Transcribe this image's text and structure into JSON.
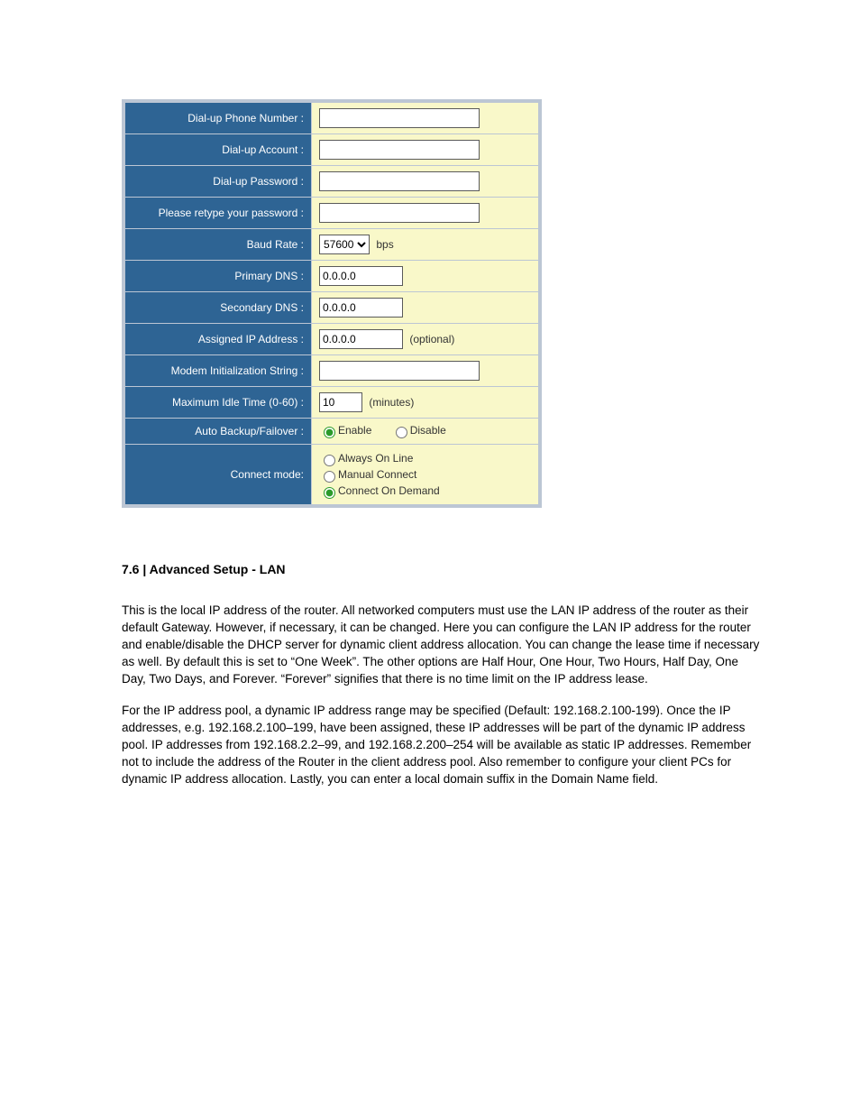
{
  "form": {
    "labels": {
      "phone": "Dial-up Phone Number :",
      "account": "Dial-up Account :",
      "password": "Dial-up Password :",
      "retype": "Please retype your password :",
      "baud": "Baud Rate :",
      "pdns": "Primary DNS :",
      "sdns": "Secondary DNS :",
      "assigned": "Assigned IP Address :",
      "modem": "Modem Initialization String :",
      "idle": "Maximum Idle Time (0-60) :",
      "backup": "Auto Backup/Failover :",
      "connect": "Connect mode:"
    },
    "values": {
      "phone": "",
      "account": "",
      "password": "",
      "retype": "",
      "baud_selected": "57600",
      "pdns": "0.0.0.0",
      "sdns": "0.0.0.0",
      "assigned": "0.0.0.0",
      "modem": "",
      "idle": "10"
    },
    "units": {
      "baud": "bps",
      "assigned": "(optional)",
      "idle": "(minutes)"
    },
    "radios": {
      "backup_enable": "Enable",
      "backup_disable": "Disable",
      "connect_always": "Always On Line",
      "connect_manual": "Manual Connect",
      "connect_demand": "Connect On Demand"
    }
  },
  "doc": {
    "heading": "7.6 | Advanced Setup - LAN",
    "para1": "This is the local IP address of the router. All networked computers must use the LAN IP address of the router as their default Gateway. However, if necessary, it can be changed. Here you can configure the LAN IP address for the router and enable/disable the DHCP server for dynamic client address allocation. You can change the lease time if necessary as well. By default this is set to “One Week”. The other options are Half Hour, One Hour, Two Hours, Half Day, One Day, Two Days, and Forever. “Forever” signifies that there is no time limit on the IP address lease.",
    "para2": "For the IP address pool, a dynamic IP address range may be specified (Default: 192.168.2.100-199). Once the IP addresses, e.g. 192.168.2.100–199, have been assigned, these IP addresses will be part of the dynamic IP address pool. IP addresses from 192.168.2.2–99, and 192.168.2.200–254 will be available as static IP addresses. Remember not to include the address of the Router in the client address pool. Also remember to configure your client PCs for dynamic IP address allocation. Lastly, you can enter a local domain suffix in the Domain Name field."
  }
}
